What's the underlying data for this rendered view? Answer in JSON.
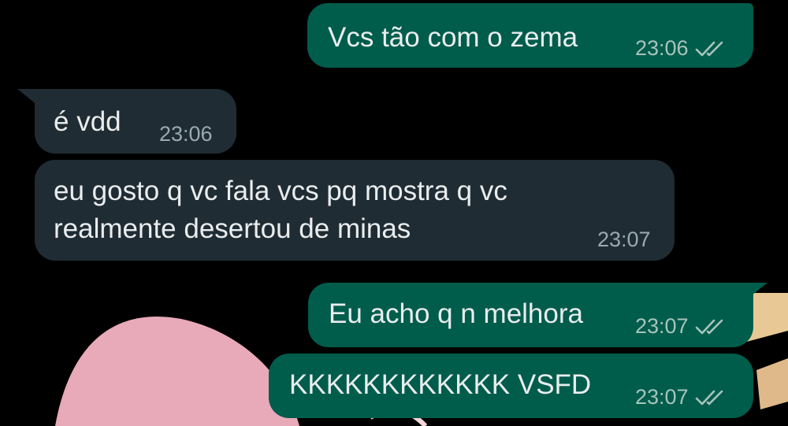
{
  "messages": [
    {
      "direction": "outgoing",
      "text": "Vcs tão com o zema",
      "time": "23:06",
      "status_icon": "double-check-icon"
    },
    {
      "direction": "incoming",
      "text": "é vdd",
      "time": "23:06"
    },
    {
      "direction": "incoming",
      "lines": [
        "eu gosto q vc fala vcs pq mostra q vc",
        "realmente desertou de minas"
      ],
      "time": "23:07"
    },
    {
      "direction": "outgoing",
      "text": "Eu acho q n melhora",
      "time": "23:07",
      "status_icon": "double-check-icon"
    },
    {
      "direction": "outgoing",
      "text": "KKKKKKKKKKKK VSFD",
      "time": "23:07",
      "status_icon": "double-check-icon"
    }
  ],
  "colors": {
    "background": "#000000",
    "outgoing_bubble": "#005c4b",
    "incoming_bubble": "#202c33",
    "text": "#e9edef",
    "timestamp": "#9aaab2"
  }
}
